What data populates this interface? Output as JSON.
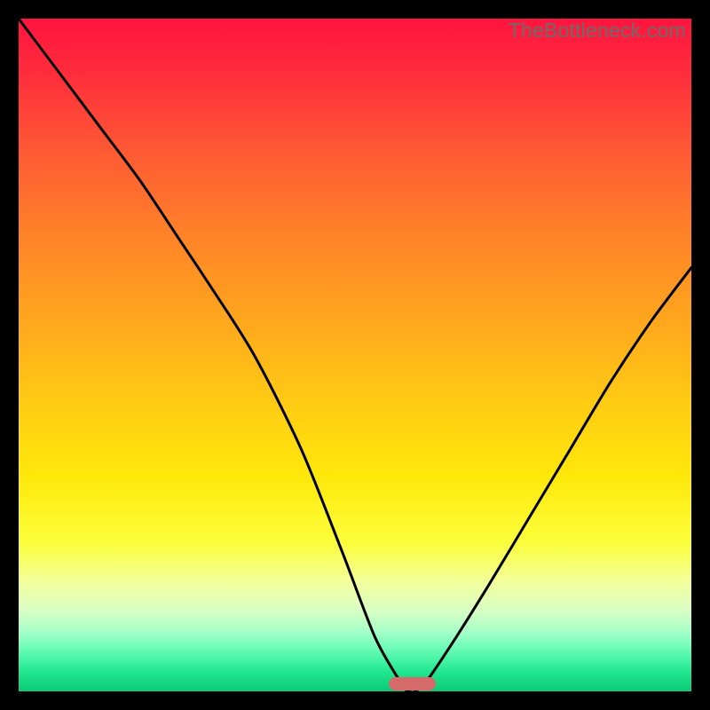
{
  "watermark": "TheBottleneck.com",
  "colors": {
    "curve_stroke": "#000000",
    "marker_fill": "#d46a6a",
    "frame_border": "#000000"
  },
  "chart_data": {
    "type": "line",
    "title": "",
    "xlabel": "",
    "ylabel": "",
    "xlim": [
      0,
      100
    ],
    "ylim": [
      0,
      100
    ],
    "axes_visible": false,
    "grid": false,
    "background_gradient": "red-to-green vertical",
    "series": [
      {
        "name": "bottleneck-curve",
        "x": [
          0,
          6,
          12,
          18,
          24,
          28,
          35,
          42,
          48,
          53,
          57,
          58,
          59,
          61,
          65,
          70,
          76,
          82,
          88,
          94,
          100
        ],
        "values": [
          100,
          92,
          84,
          76,
          67,
          61,
          50,
          36,
          21,
          8,
          1,
          0,
          0,
          2,
          8,
          16,
          26,
          36,
          46,
          55,
          63
        ]
      }
    ],
    "marker": {
      "name": "optimal-range",
      "x_start": 55,
      "x_end": 62,
      "y": 0,
      "color": "#d46a6a"
    }
  }
}
